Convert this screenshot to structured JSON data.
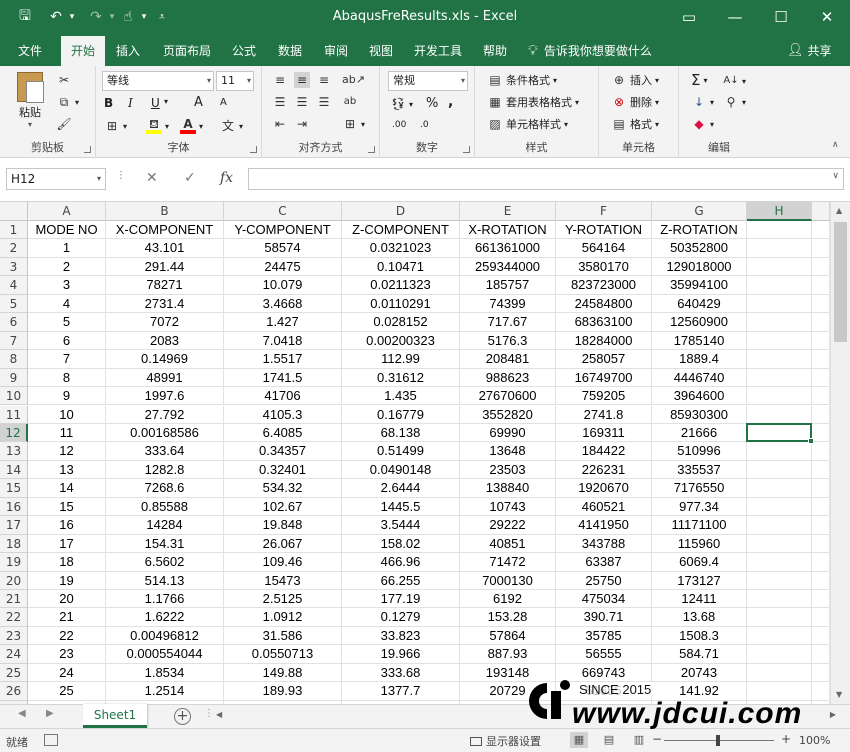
{
  "window": {
    "title": "AbaqusFreResults.xls  -  Excel",
    "controls": [
      "▭",
      "—",
      "☐",
      "✕"
    ]
  },
  "quick_access": [
    {
      "name": "save-icon",
      "glyph": "🖫"
    },
    {
      "name": "undo-icon",
      "glyph": "↶"
    },
    {
      "name": "undo-dropdown-icon",
      "glyph": "▾"
    },
    {
      "name": "redo-icon",
      "glyph": "↷"
    },
    {
      "name": "redo-dropdown-icon",
      "glyph": "▾"
    },
    {
      "name": "touch-mode-icon",
      "glyph": "☝"
    },
    {
      "name": "touch-dropdown-icon",
      "glyph": "▾"
    },
    {
      "name": "customize-qat-icon",
      "glyph": "⩡"
    }
  ],
  "tabs": [
    "文件",
    "开始",
    "插入",
    "页面布局",
    "公式",
    "数据",
    "审阅",
    "视图",
    "开发工具",
    "帮助"
  ],
  "active_tab": "开始",
  "tell_me": "告诉我你想要做什么",
  "share": "共享",
  "ribbon": {
    "clipboard": {
      "label": "剪贴板",
      "paste": "粘贴"
    },
    "font": {
      "label": "字体",
      "family": "等线",
      "size": "11",
      "bold": "B",
      "italic": "I",
      "underline": "U",
      "grow": "A",
      "shrink": "A",
      "fill_color": "#ffff00",
      "font_color": "#ff0000",
      "phonetic": "文"
    },
    "alignment": {
      "label": "对齐方式",
      "wrap": "ab",
      "merge": "⊞"
    },
    "number": {
      "label": "数字",
      "format": "常规",
      "percent": "%",
      "comma": ",",
      "inc": ".00",
      "dec": ".0"
    },
    "styles": {
      "label": "样式",
      "cond": "条件格式",
      "table": "套用表格格式",
      "cell": "单元格样式"
    },
    "cells": {
      "label": "单元格",
      "insert": "插入",
      "delete": "删除",
      "format": "格式"
    },
    "editing": {
      "label": "编辑",
      "sum": "Σ",
      "sort": "A↓",
      "fill": "↓",
      "find": "⚲",
      "clear": "◆"
    }
  },
  "formula_bar": {
    "name_box": "H12",
    "fx": "fx",
    "formula": ""
  },
  "grid": {
    "columns": [
      "A",
      "B",
      "C",
      "D",
      "E",
      "F",
      "G",
      "H"
    ],
    "active_cell": "H12",
    "active_column": "H",
    "active_row": "12",
    "header": [
      "MODE NO",
      "X-COMPONENT",
      "Y-COMPONENT",
      "Z-COMPONENT",
      "X-ROTATION",
      "Y-ROTATION",
      "Z-ROTATION"
    ],
    "rows": [
      [
        "1",
        "43.101",
        "58574",
        "0.0321023",
        "661361000",
        "564164",
        "50352800"
      ],
      [
        "2",
        "291.44",
        "24475",
        "0.10471",
        "259344000",
        "3580170",
        "129018000"
      ],
      [
        "3",
        "78271",
        "10.079",
        "0.0211323",
        "185757",
        "823723000",
        "35994100"
      ],
      [
        "4",
        "2731.4",
        "3.4668",
        "0.0110291",
        "74399",
        "24584800",
        "640429"
      ],
      [
        "5",
        "7072",
        "1.427",
        "0.028152",
        "717.67",
        "68363100",
        "12560900"
      ],
      [
        "6",
        "2083",
        "7.0418",
        "0.00200323",
        "5176.3",
        "18284000",
        "1785140"
      ],
      [
        "7",
        "0.14969",
        "1.5517",
        "112.99",
        "208481",
        "258057",
        "1889.4"
      ],
      [
        "8",
        "48991",
        "1741.5",
        "0.31612",
        "988623",
        "16749700",
        "4446740"
      ],
      [
        "9",
        "1997.6",
        "41706",
        "1.435",
        "27670600",
        "759205",
        "3964600"
      ],
      [
        "10",
        "27.792",
        "4105.3",
        "0.16779",
        "3552820",
        "2741.8",
        "85930300"
      ],
      [
        "11",
        "0.00168586",
        "6.4085",
        "68.138",
        "69990",
        "169311",
        "21666"
      ],
      [
        "12",
        "333.64",
        "0.34357",
        "0.51499",
        "13648",
        "184422",
        "510996"
      ],
      [
        "13",
        "1282.8",
        "0.32401",
        "0.0490148",
        "23503",
        "226231",
        "335537"
      ],
      [
        "14",
        "7268.6",
        "534.32",
        "2.6444",
        "138840",
        "1920670",
        "7176550"
      ],
      [
        "15",
        "0.85588",
        "102.67",
        "1445.5",
        "10743",
        "460521",
        "977.34"
      ],
      [
        "16",
        "14284",
        "19.848",
        "3.5444",
        "29222",
        "4141950",
        "11171100"
      ],
      [
        "17",
        "154.31",
        "26.067",
        "158.02",
        "40851",
        "343788",
        "115960"
      ],
      [
        "18",
        "6.5602",
        "109.46",
        "466.96",
        "71472",
        "63387",
        "6069.4"
      ],
      [
        "19",
        "514.13",
        "15473",
        "66.255",
        "7000130",
        "25750",
        "173127"
      ],
      [
        "20",
        "1.1766",
        "2.5125",
        "177.19",
        "6192",
        "475034",
        "12411"
      ],
      [
        "21",
        "1.6222",
        "1.0912",
        "0.1279",
        "153.28",
        "390.71",
        "13.68"
      ],
      [
        "22",
        "0.00496812",
        "31.586",
        "33.823",
        "57864",
        "35785",
        "1508.3"
      ],
      [
        "23",
        "0.000554044",
        "0.0550713",
        "19.966",
        "887.93",
        "56555",
        "584.71"
      ],
      [
        "24",
        "1.8534",
        "149.88",
        "333.68",
        "193148",
        "669743",
        "20743"
      ],
      [
        "25",
        "1.2514",
        "189.93",
        "1377.7",
        "20729",
        "61655",
        "141.92"
      ]
    ]
  },
  "sheet_tabs": [
    "Sheet1"
  ],
  "status": {
    "ready": "就绪",
    "display_settings": "显示器设置",
    "zoom": "100%"
  },
  "watermark": {
    "since": "SINCE 2015",
    "url": "www.jdcui.com"
  }
}
